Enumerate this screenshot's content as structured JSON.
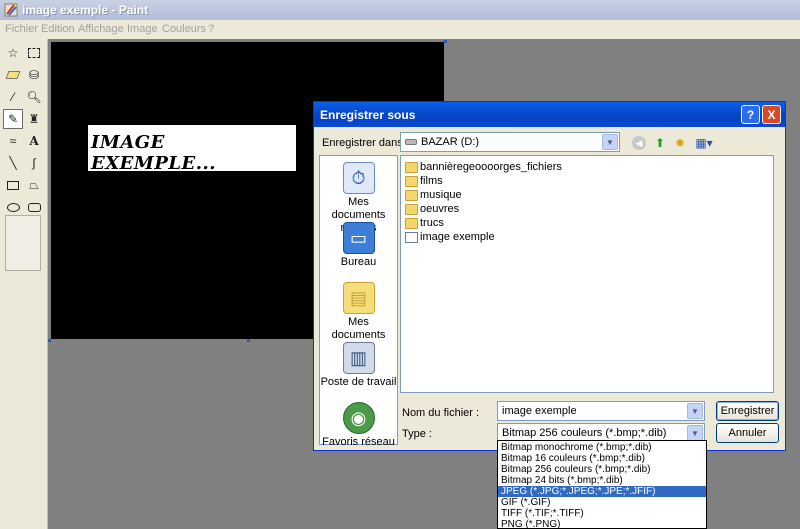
{
  "window": {
    "title": "image exemple - Paint"
  },
  "menu": [
    "Fichier",
    "Edition",
    "Affichage",
    "Image",
    "Couleurs",
    "?"
  ],
  "toolbox": {
    "tools": [
      "free-select",
      "rect-select",
      "eraser",
      "fill",
      "color-picker",
      "magnifier",
      "pencil",
      "brush",
      "airbrush",
      "text",
      "line",
      "curve",
      "rectangle",
      "polygon",
      "ellipse",
      "rounded-rectangle"
    ],
    "active": "pencil"
  },
  "canvas": {
    "text": "IMAGE EXEMPLE..."
  },
  "dialog": {
    "title": "Enregistrer sous",
    "help_btn": "?",
    "close_btn": "X",
    "save_in_label": "Enregistrer dans :",
    "save_in_value": "BAZAR (D:)",
    "places": [
      {
        "label": "Mes documents récents",
        "icon": "recent-documents-icon"
      },
      {
        "label": "Bureau",
        "icon": "desktop-icon"
      },
      {
        "label": "Mes documents",
        "icon": "my-documents-icon"
      },
      {
        "label": "Poste de travail",
        "icon": "my-computer-icon"
      },
      {
        "label": "Favoris réseau",
        "icon": "network-icon"
      }
    ],
    "files": [
      {
        "name": "bannièregeoooorges_fichiers",
        "icon": "folder-icon"
      },
      {
        "name": "films",
        "icon": "folder-icon"
      },
      {
        "name": "musique",
        "icon": "folder-icon"
      },
      {
        "name": "oeuvres",
        "icon": "folder-icon"
      },
      {
        "name": "trucs",
        "icon": "folder-icon"
      },
      {
        "name": "image exemple",
        "icon": "image-file-icon"
      }
    ],
    "filename_label": "Nom du fichier :",
    "filename_value": "image exemple",
    "type_label": "Type :",
    "type_value": "Bitmap 256 couleurs (*.bmp;*.dib)",
    "save_button": "Enregistrer",
    "cancel_button": "Annuler"
  },
  "type_options": [
    "Bitmap monochrome (*.bmp;*.dib)",
    "Bitmap 16 couleurs (*.bmp;*.dib)",
    "Bitmap 256 couleurs (*.bmp;*.dib)",
    "Bitmap 24 bits (*.bmp;*.dib)",
    "JPEG (*.JPG;*.JPEG;*.JPE;*.JFIF)",
    "GIF (*.GIF)",
    "TIFF (*.TIF;*.TIFF)",
    "PNG (*.PNG)"
  ],
  "type_selected_index": 4
}
